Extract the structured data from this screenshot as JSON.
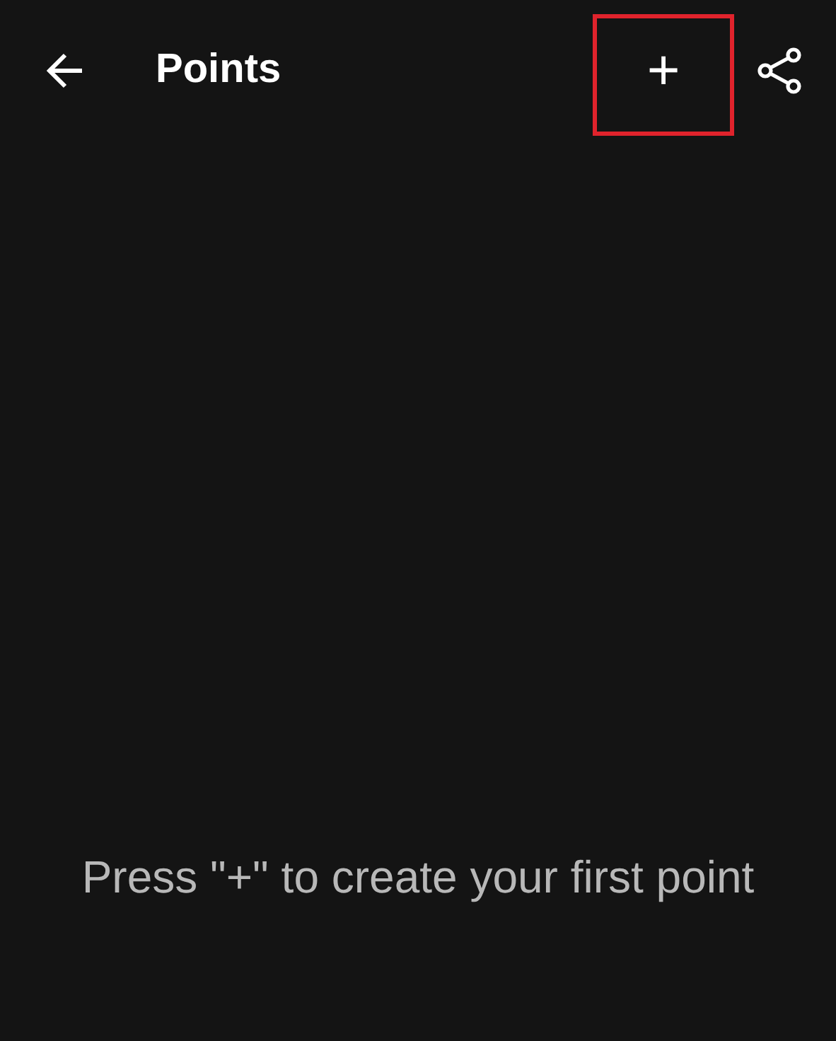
{
  "app_bar": {
    "title": "Points",
    "add_button": {
      "label": "+",
      "highlighted": true
    }
  },
  "empty_message": "Press \"+\" to create your first point"
}
